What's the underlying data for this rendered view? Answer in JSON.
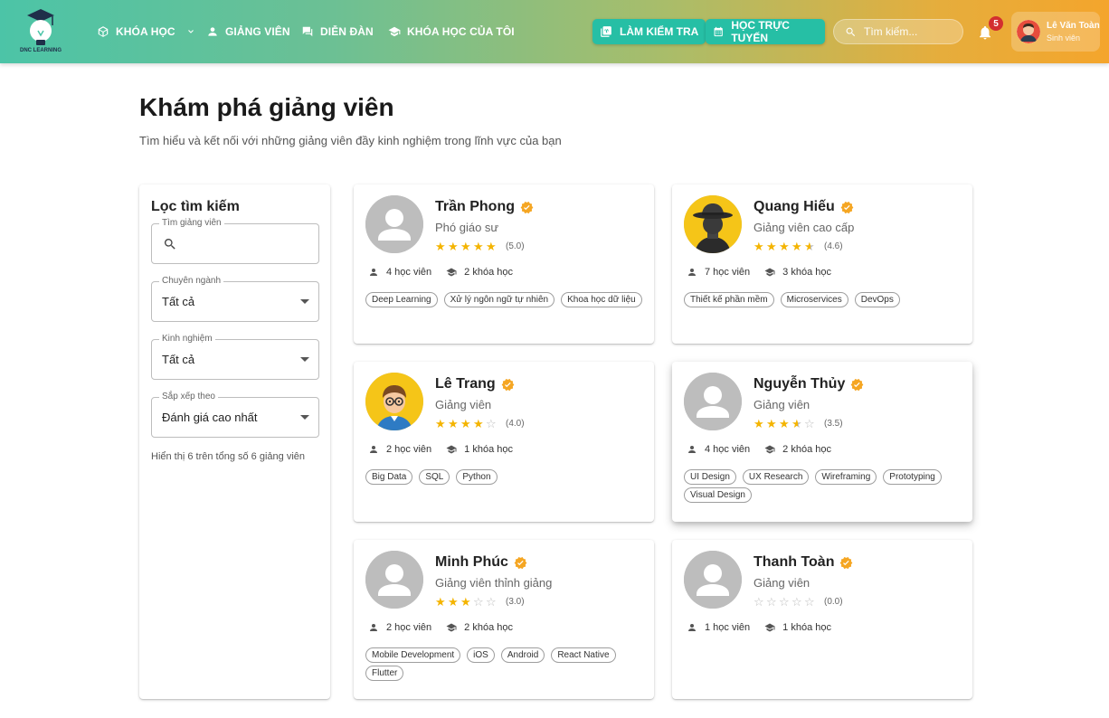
{
  "brand": {
    "logo_text": "DNC LEARNING",
    "accent": "#26bfa5"
  },
  "nav": {
    "courses": "KHÓA HỌC",
    "instructors": "GIẢNG VIÊN",
    "forum": "DIỄN ĐÀN",
    "my_courses": "KHÓA HỌC CỦA TÔI"
  },
  "actions": {
    "test": "LÀM KIỂM TRA",
    "online": "HỌC TRỰC TUYẾN"
  },
  "search": {
    "placeholder": "Tìm kiếm..."
  },
  "notifications": {
    "count": "5"
  },
  "user": {
    "name": "Lê Văn Toàn",
    "role": "Sinh viên"
  },
  "page": {
    "title": "Khám phá giảng viên",
    "subtitle": "Tìm hiểu và kết nối với những giảng viên đầy kinh nghiệm trong lĩnh vực của bạn"
  },
  "filter": {
    "title": "Lọc tìm kiếm",
    "search_label": "Tìm giảng viên",
    "major_label": "Chuyên ngành",
    "major_value": "Tất cả",
    "experience_label": "Kinh nghiệm",
    "experience_value": "Tất cả",
    "sort_label": "Sắp xếp theo",
    "sort_value": "Đánh giá cao nhất",
    "count_text": "Hiển thị 6 trên tổng số 6 giảng viên"
  },
  "instructors": [
    {
      "name": "Trần Phong",
      "title": "Phó giáo sư",
      "rating": 5.0,
      "rating_text": "(5.0)",
      "students": "4 học viên",
      "courses": "2 khóa học",
      "tags": [
        "Deep Learning",
        "Xử lý ngôn ngữ tự nhiên",
        "Khoa học dữ liệu"
      ],
      "avatar": "default"
    },
    {
      "name": "Quang Hiếu",
      "title": "Giảng viên cao cấp",
      "rating": 4.6,
      "rating_text": "(4.6)",
      "students": "7 học viên",
      "courses": "3 khóa học",
      "tags": [
        "Thiết kế phần mềm",
        "Microservices",
        "DevOps"
      ],
      "avatar": "spy"
    },
    {
      "name": "Lê Trang",
      "title": "Giảng viên",
      "rating": 4.0,
      "rating_text": "(4.0)",
      "students": "2 học viên",
      "courses": "1 khóa học",
      "tags": [
        "Big Data",
        "SQL",
        "Python"
      ],
      "avatar": "nerd"
    },
    {
      "name": "Nguyễn Thủy",
      "title": "Giảng viên",
      "rating": 3.5,
      "rating_text": "(3.5)",
      "students": "4 học viên",
      "courses": "2 khóa học",
      "tags": [
        "UI Design",
        "UX Research",
        "Wireframing",
        "Prototyping",
        "Visual Design"
      ],
      "avatar": "default"
    },
    {
      "name": "Minh Phúc",
      "title": "Giảng viên thỉnh giảng",
      "rating": 3.0,
      "rating_text": "(3.0)",
      "students": "2 học viên",
      "courses": "2 khóa học",
      "tags": [
        "Mobile Development",
        "iOS",
        "Android",
        "React Native",
        "Flutter"
      ],
      "avatar": "default"
    },
    {
      "name": "Thanh Toàn",
      "title": "Giảng viên",
      "rating": 0.0,
      "rating_text": "(0.0)",
      "students": "1 học viên",
      "courses": "1 khóa học",
      "tags": [],
      "avatar": "default"
    }
  ]
}
